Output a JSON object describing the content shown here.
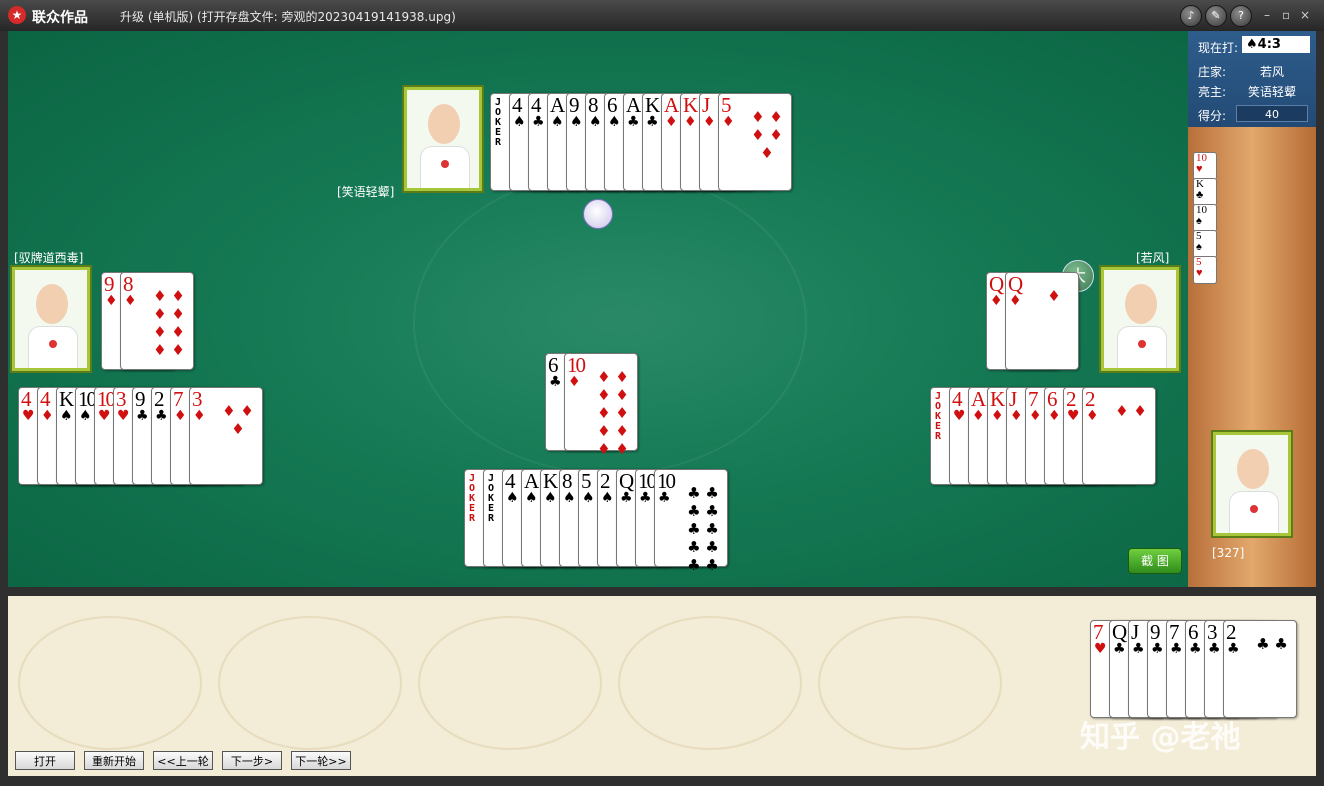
{
  "titlebar": {
    "brand": "联众作品",
    "title": "升级 (单机版) (打开存盘文件: 旁观的20230419141938.upg)",
    "buttons": [
      "sound-icon",
      "tools-icon",
      "help-icon"
    ],
    "window_controls": [
      "–",
      "▫",
      "×"
    ]
  },
  "sidebar": {
    "now_label": "现在打:",
    "now_value": "♠4:3",
    "dealer_label": "庄家:",
    "dealer_value": "若风",
    "trump_label": "亮主:",
    "trump_value": "笑语轻颦",
    "score_label": "得分:",
    "score_value": "40",
    "score_cards": [
      {
        "rank": "10",
        "suit": "♥",
        "color": "red"
      },
      {
        "rank": "K",
        "suit": "♣",
        "color": "black"
      },
      {
        "rank": "10",
        "suit": "♠",
        "color": "black"
      },
      {
        "rank": "5",
        "suit": "♠",
        "color": "black"
      },
      {
        "rank": "5",
        "suit": "♥",
        "color": "red"
      }
    ]
  },
  "players": {
    "top": {
      "name": "[笑语轻颦]"
    },
    "left": {
      "name": "[驭牌道西毒]"
    },
    "right": {
      "name": "[若风]"
    },
    "self": {
      "id": "[327]"
    }
  },
  "hands": {
    "top": [
      {
        "rank": "JOKER",
        "suit": "",
        "color": "black"
      },
      {
        "rank": "4",
        "suit": "♠",
        "color": "black"
      },
      {
        "rank": "4",
        "suit": "♣",
        "color": "black"
      },
      {
        "rank": "A",
        "suit": "♠",
        "color": "black"
      },
      {
        "rank": "9",
        "suit": "♠",
        "color": "black"
      },
      {
        "rank": "8",
        "suit": "♠",
        "color": "black"
      },
      {
        "rank": "6",
        "suit": "♠",
        "color": "black"
      },
      {
        "rank": "A",
        "suit": "♣",
        "color": "black"
      },
      {
        "rank": "K",
        "suit": "♣",
        "color": "black"
      },
      {
        "rank": "A",
        "suit": "♦",
        "color": "red"
      },
      {
        "rank": "K",
        "suit": "♦",
        "color": "red"
      },
      {
        "rank": "J",
        "suit": "♦",
        "color": "red"
      },
      {
        "rank": "5",
        "suit": "♦",
        "color": "red"
      }
    ],
    "left": [
      {
        "rank": "4",
        "suit": "♥",
        "color": "red"
      },
      {
        "rank": "4",
        "suit": "♦",
        "color": "red"
      },
      {
        "rank": "K",
        "suit": "♠",
        "color": "black"
      },
      {
        "rank": "10",
        "suit": "♠",
        "color": "black"
      },
      {
        "rank": "10",
        "suit": "♥",
        "color": "red"
      },
      {
        "rank": "3",
        "suit": "♥",
        "color": "red"
      },
      {
        "rank": "9",
        "suit": "♣",
        "color": "black"
      },
      {
        "rank": "2",
        "suit": "♣",
        "color": "black"
      },
      {
        "rank": "7",
        "suit": "♦",
        "color": "red"
      },
      {
        "rank": "3",
        "suit": "♦",
        "color": "red"
      }
    ],
    "right": [
      {
        "rank": "JOKER",
        "suit": "",
        "color": "red"
      },
      {
        "rank": "4",
        "suit": "♥",
        "color": "red"
      },
      {
        "rank": "A",
        "suit": "♦",
        "color": "red"
      },
      {
        "rank": "K",
        "suit": "♦",
        "color": "red"
      },
      {
        "rank": "J",
        "suit": "♦",
        "color": "red"
      },
      {
        "rank": "7",
        "suit": "♦",
        "color": "red"
      },
      {
        "rank": "6",
        "suit": "♦",
        "color": "red"
      },
      {
        "rank": "2",
        "suit": "♥",
        "color": "red"
      },
      {
        "rank": "2",
        "suit": "♦",
        "color": "red"
      }
    ],
    "bottom": [
      {
        "rank": "JOKER",
        "suit": "",
        "color": "red"
      },
      {
        "rank": "JOKER",
        "suit": "",
        "color": "black"
      },
      {
        "rank": "4",
        "suit": "♠",
        "color": "black"
      },
      {
        "rank": "A",
        "suit": "♠",
        "color": "black"
      },
      {
        "rank": "K",
        "suit": "♠",
        "color": "black"
      },
      {
        "rank": "8",
        "suit": "♠",
        "color": "black"
      },
      {
        "rank": "5",
        "suit": "♠",
        "color": "black"
      },
      {
        "rank": "2",
        "suit": "♠",
        "color": "black"
      },
      {
        "rank": "Q",
        "suit": "♣",
        "color": "black"
      },
      {
        "rank": "10",
        "suit": "♣",
        "color": "black"
      },
      {
        "rank": "10",
        "suit": "♣",
        "color": "black"
      }
    ],
    "tray": [
      {
        "rank": "7",
        "suit": "♥",
        "color": "red"
      },
      {
        "rank": "Q",
        "suit": "♣",
        "color": "black"
      },
      {
        "rank": "J",
        "suit": "♣",
        "color": "black"
      },
      {
        "rank": "9",
        "suit": "♣",
        "color": "black"
      },
      {
        "rank": "7",
        "suit": "♣",
        "color": "black"
      },
      {
        "rank": "6",
        "suit": "♣",
        "color": "black"
      },
      {
        "rank": "3",
        "suit": "♣",
        "color": "black"
      },
      {
        "rank": "2",
        "suit": "♣",
        "color": "black"
      }
    ]
  },
  "played": {
    "left": [
      {
        "rank": "9",
        "suit": "♦",
        "color": "red"
      },
      {
        "rank": "8",
        "suit": "♦",
        "color": "red"
      }
    ],
    "center": [
      {
        "rank": "6",
        "suit": "♣",
        "color": "black"
      },
      {
        "rank": "10",
        "suit": "♦",
        "color": "red"
      }
    ],
    "right": [
      {
        "rank": "Q",
        "suit": "♦",
        "color": "red"
      },
      {
        "rank": "Q",
        "suit": "♦",
        "color": "red"
      }
    ]
  },
  "badges": {
    "big": "大",
    "screenshot": "截 图"
  },
  "controls": {
    "open": "打开",
    "restart": "重新开始",
    "prev": "<<上一轮",
    "next_step": "下一步>",
    "next_round": "下一轮>>"
  },
  "watermark": "知乎 @老祂"
}
